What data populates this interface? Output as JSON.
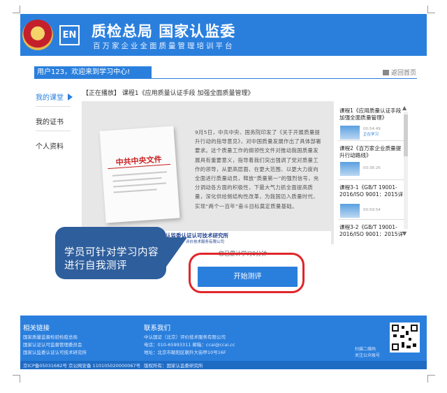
{
  "header": {
    "logo_text": "EN",
    "title": "质检总局   国家认监委",
    "subtitle": "百万家企业全面质量管理培训平台"
  },
  "welcome": "用户123，欢迎来到学习中心!",
  "home_link": "返回首页",
  "sidebar": {
    "items": [
      {
        "label": "我的课堂",
        "active": true
      },
      {
        "label": "我的证书",
        "active": false
      },
      {
        "label": "个人资料",
        "active": false
      }
    ]
  },
  "now_playing": "【正在播放】 课程1《应用质量认证手段 加强全面质量管理》",
  "video": {
    "doc_title": "中共中央文件",
    "paragraph": "9月5日，中共中央、国务院印发了《关于开展质量提升行动的指导意见》，对中国质量发展作出了具体部署要求。这个质量工作的纲领性文件对推动我国质量发展具有重要意义，指导着我们突出强调了党对质量工作的领导，从更高层面、在更大范围、以更大力度向全面进行质量动员，释放“质量第一”的强烈信号，充分调动各方面的积极性，下最大气力抓全面提高质量，深化供给侧结构性改革，为我国迈入质量时代、实现“两个一百年”奋斗目标奠定质量基础。",
    "footer_org": "国家认监委认证认可技术研究所",
    "footer_sub": "中认国证（北京）评价技术服务有限公司"
  },
  "playlist": [
    {
      "title": "课程1《应用质量认证手段 加强全面质量管理》",
      "duration": "00:54:49",
      "status": "正在学习"
    },
    {
      "title": "课程2《百万家企业质量提升行动路线》",
      "duration": "00:38:26",
      "status": ""
    },
    {
      "title": "课程3-1《GB/T 19001-2016/ISO 9001：2015详",
      "duration": "00:59:54",
      "status": ""
    },
    {
      "title": "课程3-2《GB/T 19001-2016/ISO 9001：2015详",
      "duration": "",
      "status": ""
    }
  ],
  "progress_text": "您已累计学习0分钟",
  "start_button": "开始测评",
  "callout": "学员可针对学习内容进行自我测评",
  "footer": {
    "links_title": "相关链接",
    "links": [
      "国家质量监督检验检疫总局",
      "国家认证认可监督管理委员会",
      "国家认监委认证认可技术研究所"
    ],
    "contact_title": "联系我们",
    "contact": [
      "中认国证（北京）评价技术服务有限公司",
      "电话：010-65993311    邮箱：ccai@ccai.cc",
      "地址：北京市朝阳区朝外大街甲10号16F"
    ],
    "qr_labels": [
      "扫描二维码",
      "关注公众账号"
    ],
    "icp": "京ICP备05031682号  京公网安备 110105020000067号",
    "copyright": "版权所有：国家认监委研究所"
  },
  "colors": {
    "brand": "#2a7fdd",
    "callout": "#2e5e9c",
    "highlight": "#e0252a"
  }
}
